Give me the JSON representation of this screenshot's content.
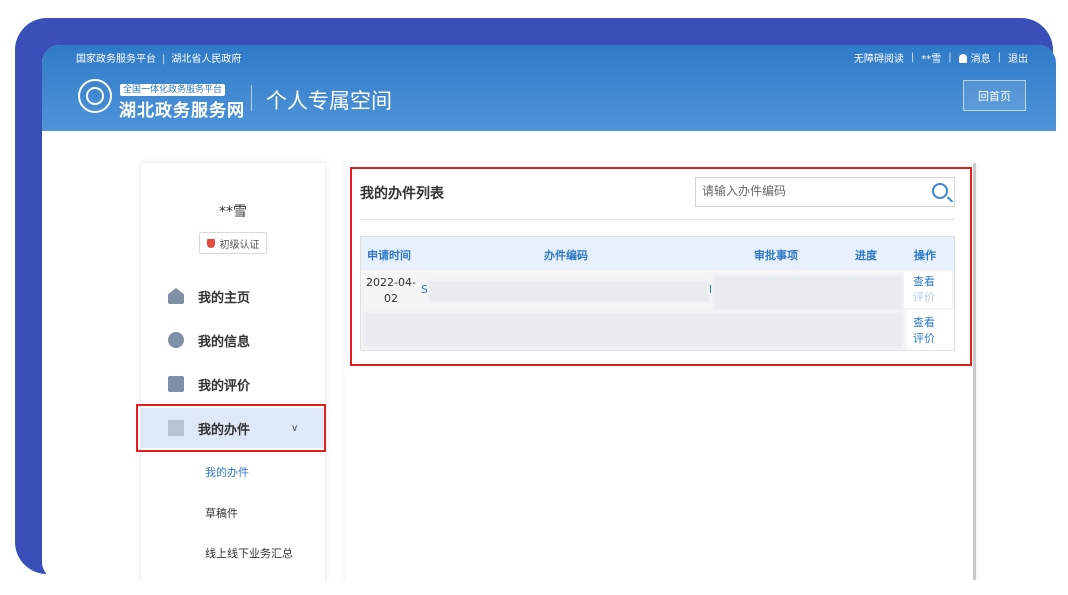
{
  "header": {
    "topbar_left": [
      "国家政务服务平台",
      "湖北省人民政府"
    ],
    "topbar_right": {
      "accessible": "无障碍阅读",
      "user": "**雪",
      "messages": "消息",
      "logout": "退出"
    },
    "logo_subtitle": "全国一体化政务服务平台",
    "logo_title": "湖北政务服务网",
    "page_title": "个人专属空间",
    "home_button": "回首页"
  },
  "sidebar": {
    "username": "**雪",
    "auth_badge": "初级认证",
    "items": [
      {
        "label": "我的主页",
        "icon": "home-icon"
      },
      {
        "label": "我的信息",
        "icon": "chat-icon"
      },
      {
        "label": "我的评价",
        "icon": "edit-icon"
      },
      {
        "label": "我的办件",
        "icon": "file-icon",
        "active": true
      }
    ],
    "sub_items": [
      "我的办件",
      "草稿件",
      "线上线下业务汇总"
    ]
  },
  "main": {
    "list_title": "我的办件列表",
    "search_placeholder": "请输入办件编码",
    "columns": [
      "申请时间",
      "办件编码",
      "审批事项",
      "进度",
      "操作"
    ],
    "rows": [
      {
        "date": "2022-04-02",
        "code_prefix": "S",
        "code_suffix": "l",
        "actions": [
          "查看",
          "评价"
        ]
      },
      {
        "date": "",
        "actions": [
          "查看",
          "评价"
        ]
      }
    ]
  },
  "colors": {
    "accent": "#2f7ac8",
    "frame": "#3a4fb8",
    "highlight": "#e02020"
  }
}
